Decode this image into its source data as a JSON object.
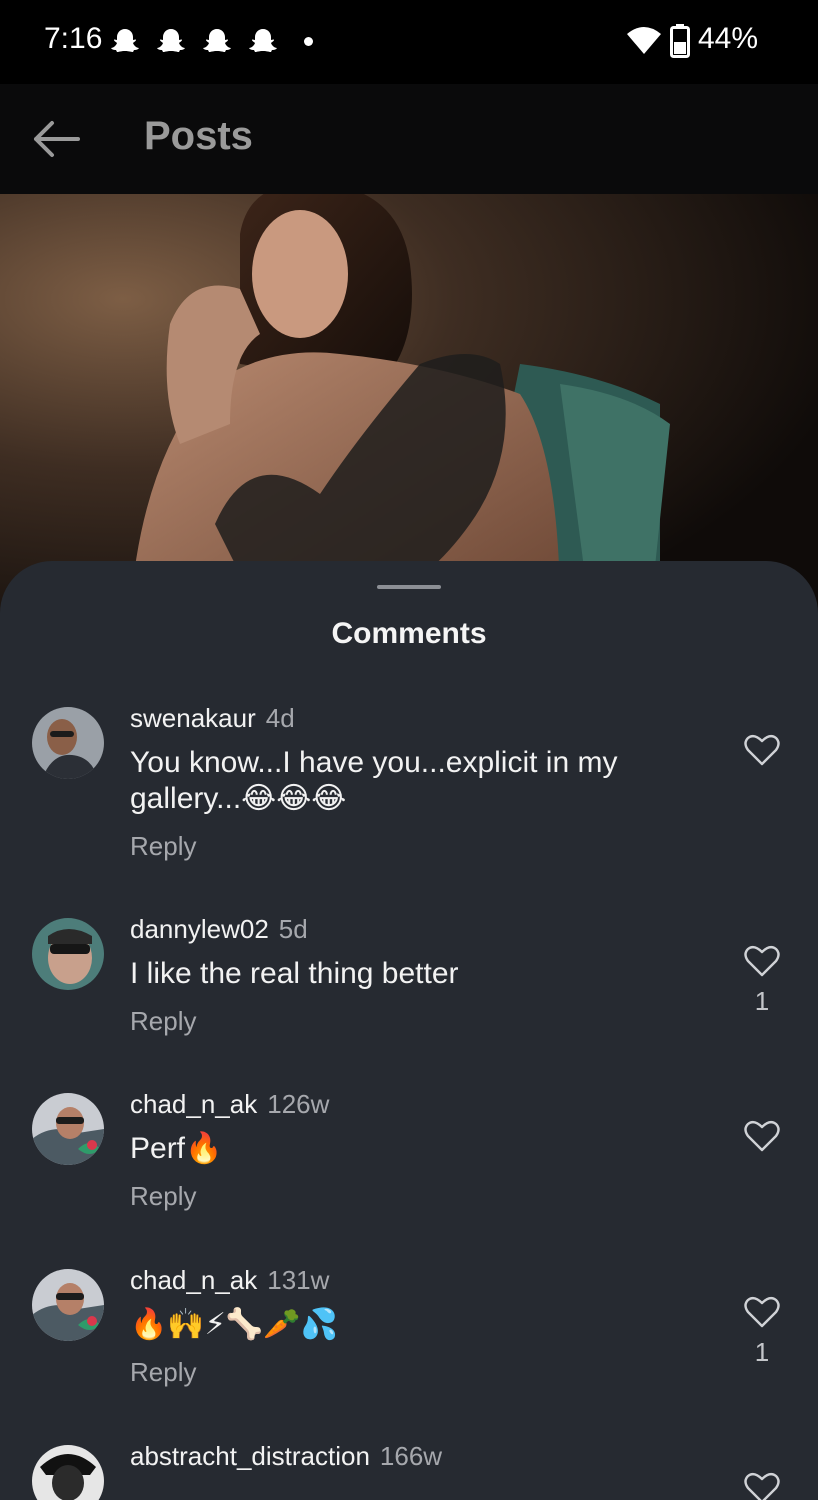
{
  "status_bar": {
    "time": "7:16",
    "notification_icons": [
      "snapchat-icon",
      "snapchat-icon",
      "snapchat-icon",
      "snapchat-icon"
    ],
    "battery": "44%"
  },
  "app_bar": {
    "title": "Posts"
  },
  "sheet": {
    "title": "Comments"
  },
  "comments": [
    {
      "username": "swenakaur",
      "time": "4d",
      "text": "You know...I have you...explicit in my gallery...😂😂😂",
      "reply_label": "Reply",
      "likes": ""
    },
    {
      "username": "dannylew02",
      "time": "5d",
      "text": "I like the real thing better",
      "reply_label": "Reply",
      "likes": "1"
    },
    {
      "username": "chad_n_ak",
      "time": "126w",
      "text": "Perf🔥",
      "reply_label": "Reply",
      "likes": ""
    },
    {
      "username": "chad_n_ak",
      "time": "131w",
      "text": "🔥🙌⚡🦴🥕💦",
      "reply_label": "Reply",
      "likes": "1"
    },
    {
      "username": "abstracht_distraction",
      "time": "166w",
      "text": "",
      "reply_label": "",
      "likes": ""
    }
  ],
  "colors": {
    "sheet_bg": "#262a31",
    "secondary_text": "#a6a8ad",
    "app_bar_bg": "#0a0a0b"
  }
}
